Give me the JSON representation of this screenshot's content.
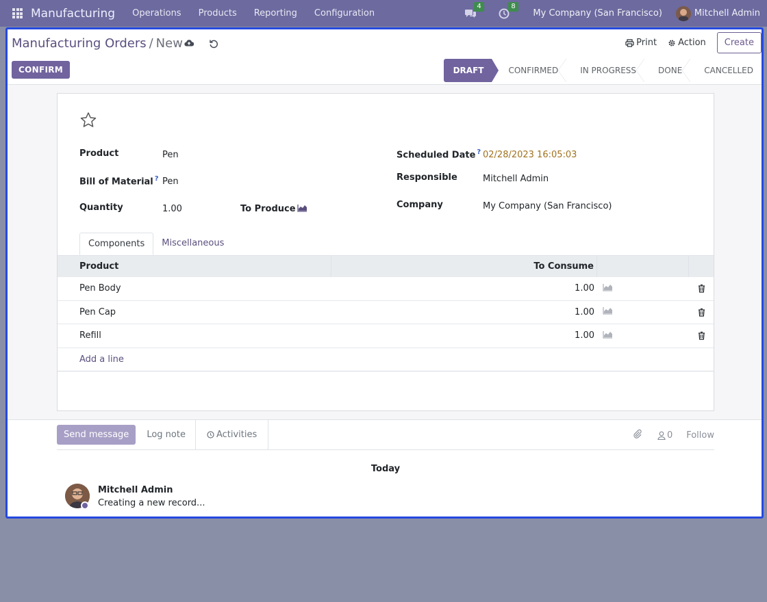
{
  "navbar": {
    "brand": "Manufacturing",
    "menu": [
      "Operations",
      "Products",
      "Reporting",
      "Configuration"
    ],
    "messages_count": "4",
    "activities_count": "8",
    "company": "My Company (San Francisco)",
    "user": "Mitchell Admin"
  },
  "breadcrumb": {
    "parent": "Manufacturing Orders",
    "separator": "/",
    "current": "New"
  },
  "actions": {
    "print": "Print",
    "action": "Action",
    "create": "Create"
  },
  "confirm_label": "CONFIRM",
  "stages": [
    "DRAFT",
    "CONFIRMED",
    "IN PROGRESS",
    "DONE",
    "CANCELLED"
  ],
  "form": {
    "product_label": "Product",
    "product_value": "Pen",
    "bom_label": "Bill of Material",
    "bom_value": "Pen",
    "qty_label": "Quantity",
    "qty_value": "1.00",
    "to_produce_label": "To Produce",
    "sched_label": "Scheduled Date",
    "sched_value": "02/28/2023 16:05:03",
    "resp_label": "Responsible",
    "resp_value": "Mitchell Admin",
    "company_label": "Company",
    "company_value": "My Company (San Francisco)",
    "help_mark": "?"
  },
  "tabs": [
    "Components",
    "Miscellaneous"
  ],
  "table": {
    "col_product": "Product",
    "col_consume": "To Consume",
    "rows": [
      {
        "product": "Pen Body",
        "qty": "1.00"
      },
      {
        "product": "Pen Cap",
        "qty": "1.00"
      },
      {
        "product": "Refill",
        "qty": "1.00"
      }
    ],
    "add_line": "Add a line"
  },
  "chatter": {
    "send": "Send message",
    "log": "Log note",
    "activities": "Activities",
    "followers": "0",
    "follow": "Follow",
    "today": "Today",
    "author": "Mitchell Admin",
    "message": "Creating a new record..."
  }
}
